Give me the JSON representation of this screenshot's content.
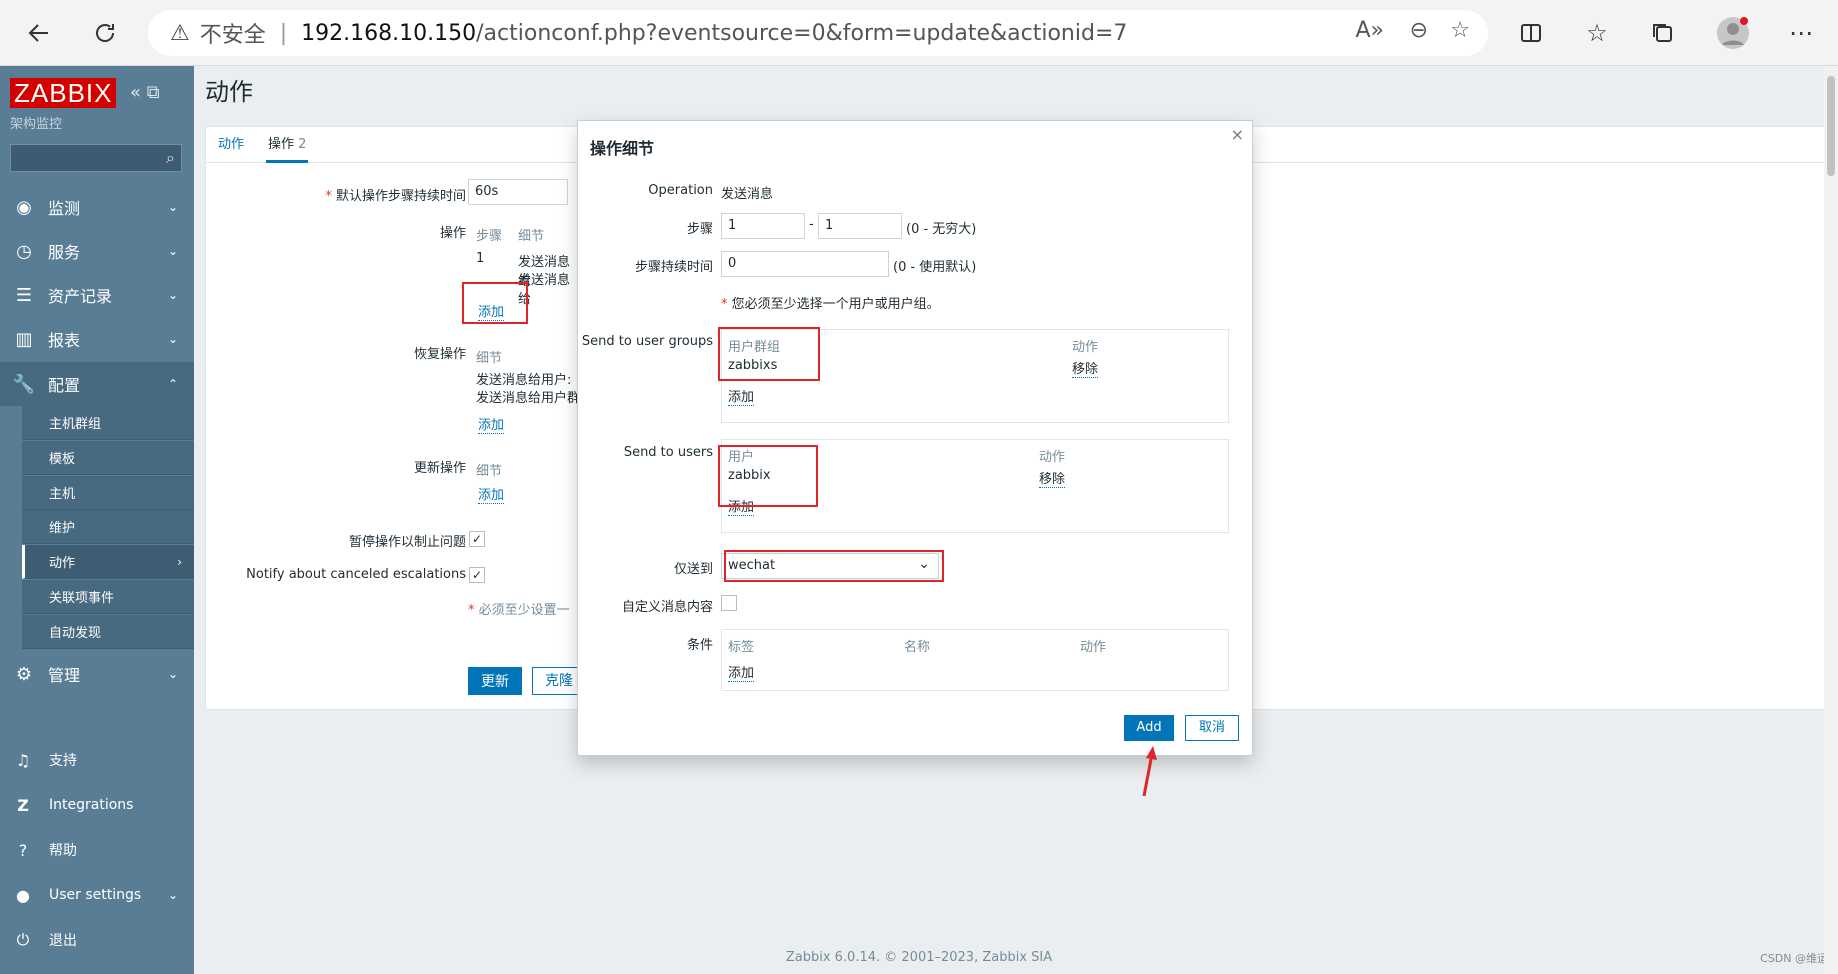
{
  "browser": {
    "security_label": "不安全",
    "url_host": "192.168.10.150",
    "url_path": "/actionconf.php?eventsource=0&form=update&actionid=7"
  },
  "sidebar": {
    "logo": "ZABBIX",
    "subtitle": "架构监控",
    "search_value": "",
    "menu": [
      {
        "label": "监测",
        "icon": "eye-icon"
      },
      {
        "label": "服务",
        "icon": "clock-icon"
      },
      {
        "label": "资产记录",
        "icon": "list-icon"
      },
      {
        "label": "报表",
        "icon": "bar-chart-icon"
      },
      {
        "label": "配置",
        "icon": "wrench-icon"
      }
    ],
    "submenu": [
      "主机群组",
      "模板",
      "主机",
      "维护",
      "动作",
      "关联项事件",
      "自动发现"
    ],
    "admin": {
      "label": "管理",
      "icon": "gear-icon"
    },
    "footer": [
      {
        "label": "支持",
        "icon": "headset-icon"
      },
      {
        "label": "Integrations",
        "icon": "zabbix-z-icon"
      },
      {
        "label": "帮助",
        "icon": "question-icon"
      },
      {
        "label": "User settings",
        "icon": "user-icon"
      },
      {
        "label": "退出",
        "icon": "power-icon"
      }
    ]
  },
  "page": {
    "title": "动作",
    "tabs": [
      {
        "label": "动作"
      },
      {
        "label": "操作",
        "count": "2"
      }
    ],
    "form": {
      "default_duration_label": "默认操作步骤持续时间",
      "default_duration_value": "60s",
      "operations_label": "操作",
      "operations_headers": [
        "步骤",
        "细节"
      ],
      "operations_row_step": "1",
      "operations_row_detail_1": "发送消息给",
      "operations_row_detail_2": "发送消息给",
      "add_link": "添加",
      "recovery_label": "恢复操作",
      "recovery_header": "细节",
      "recovery_detail_1": "发送消息给用户:",
      "recovery_detail_2": "发送消息给用户群",
      "update_label": "更新操作",
      "update_header": "细节",
      "pause_label": "暂停操作以制止问题",
      "pause_checked": true,
      "notify_label": "Notify about canceled escalations",
      "notify_checked": true,
      "required_note": "必须至少设置一",
      "update_button": "更新",
      "clone_button": "克隆"
    },
    "footer": "Zabbix 6.0.14. © 2001–2023, Zabbix SIA",
    "watermark": "CSDN @维运"
  },
  "modal": {
    "title": "操作细节",
    "operation_label": "Operation",
    "operation_value": "发送消息",
    "steps_label": "步骤",
    "steps_from": "1",
    "steps_to": "1",
    "steps_hint": "(0 - 无穷大)",
    "duration_label": "步骤持续时间",
    "duration_value": "0",
    "duration_hint": "(0 - 使用默认)",
    "required_note": "您必须至少选择一个用户或用户组。",
    "groups_label": "Send to user groups",
    "groups_header": "用户群组",
    "groups_action_header": "动作",
    "groups_row": "zabbixs",
    "groups_remove": "移除",
    "groups_add": "添加",
    "users_label": "Send to users",
    "users_header": "用户",
    "users_action_header": "动作",
    "users_row": "zabbix",
    "users_remove": "移除",
    "users_add": "添加",
    "sendonly_label": "仅送到",
    "sendonly_value": "wechat",
    "custom_msg_label": "自定义消息内容",
    "custom_msg_checked": false,
    "conditions_label": "条件",
    "conditions_headers": [
      "标签",
      "名称",
      "动作"
    ],
    "conditions_add": "添加",
    "add_button": "Add",
    "cancel_button": "取消"
  },
  "colors": {
    "accent": "#0275b8",
    "sidebar": "#5a7d96",
    "annotation_red": "#e0252a"
  }
}
